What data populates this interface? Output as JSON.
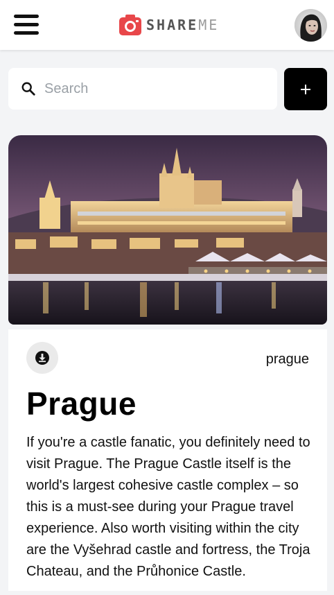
{
  "header": {
    "logo_text_dark": "SHARE",
    "logo_text_light": "ME",
    "menu_icon": "hamburger-menu-icon",
    "avatar_alt": "user-avatar"
  },
  "search": {
    "placeholder": "Search",
    "value": ""
  },
  "actions": {
    "add_icon": "plus-icon"
  },
  "pin": {
    "destination": "prague",
    "title": "Prague",
    "description": "If you're a castle fanatic, you definitely need to visit Prague. The Prague Castle itself is the world's largest cohesive castle complex – so this is a must-see during your Prague travel experience. Also worth visiting within the city are the Vyšehrad castle and fortress, the Troja Chateau, and the Průhonice Castle.",
    "download_icon": "download-icon"
  },
  "colors": {
    "logo_accent": "#e8474a",
    "add_button": "#000000",
    "page_background": "#f3f4f6"
  }
}
